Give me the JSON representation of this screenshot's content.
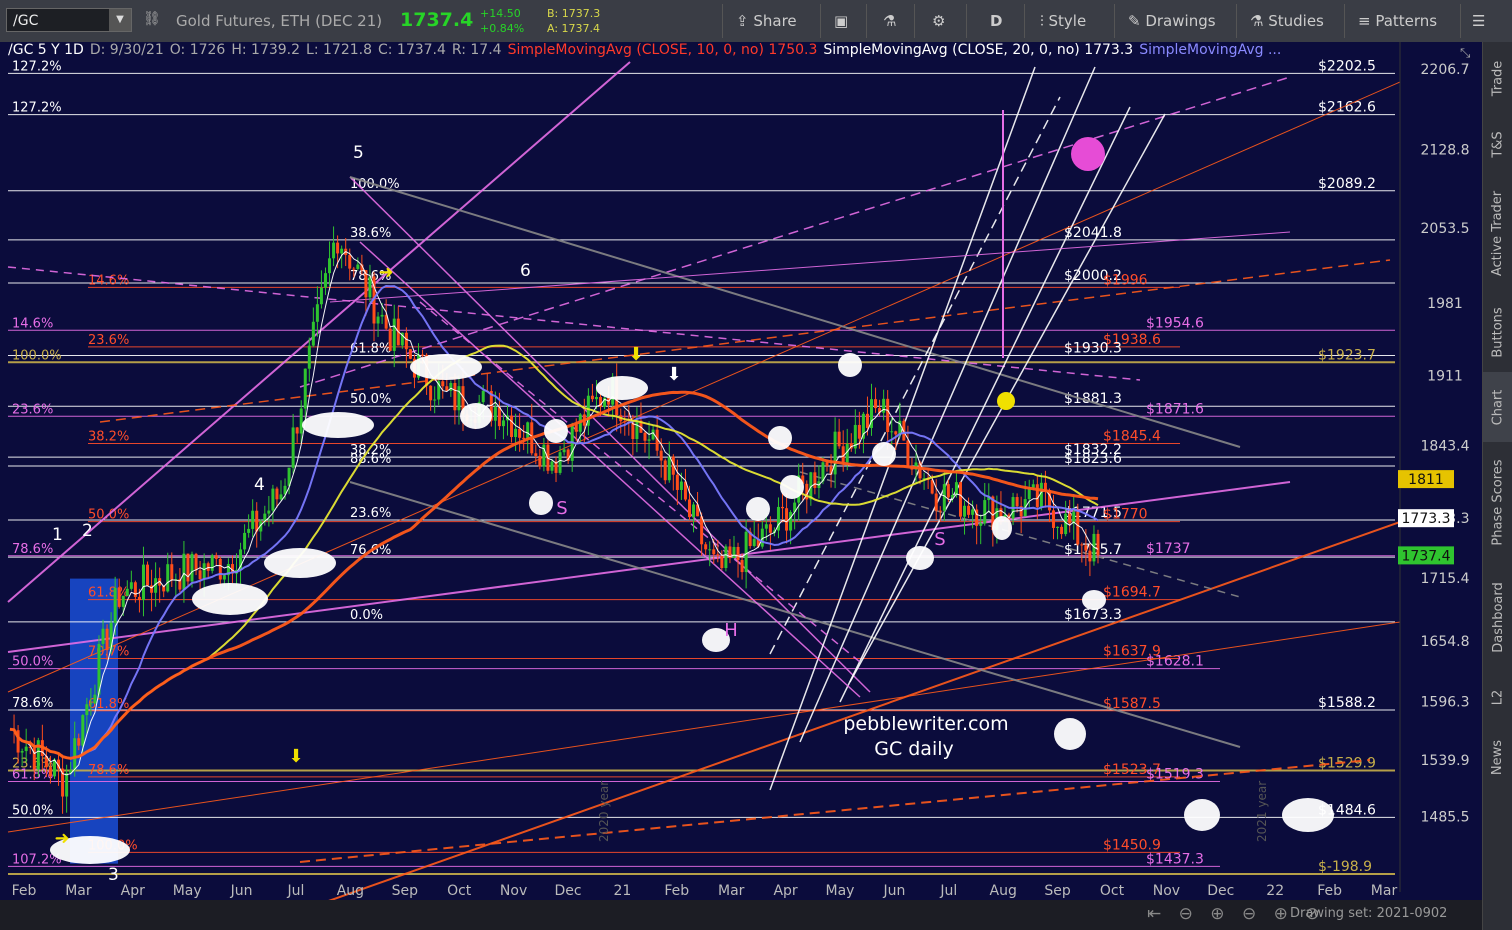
{
  "toolbar": {
    "symbol": "/GC",
    "title": "Gold Futures, ETH (DEC 21)",
    "last": "1737.4",
    "change": "+14.50",
    "change_pct": "+0.84%",
    "bid": "B: 1737.3",
    "ask": "A: 1737.4",
    "share": "Share",
    "period": "D",
    "style": "Style",
    "drawings": "Drawings",
    "studies": "Studies",
    "patterns": "Patterns"
  },
  "legend": {
    "symbol_info": "/GC 5 Y 1D",
    "date": "D: 9/30/21",
    "open": "O: 1726",
    "high": "H: 1739.2",
    "low": "L: 1721.8",
    "close": "C: 1737.4",
    "range": "R: 17.4",
    "sma10": "SimpleMovingAvg (CLOSE, 10, 0, no) 1750.3",
    "sma20": "SimpleMovingAvg (CLOSE, 20, 0, no) 1773.3",
    "sma_more": "SimpleMovingAvg ..."
  },
  "sidebar": [
    "Trade",
    "T&S",
    "Active Trader",
    "Buttons",
    "Chart",
    "Phase Scores",
    "Dashboard",
    "L2",
    "News"
  ],
  "watermark": "pebblewriter.com\nGC daily",
  "watermark_lines": [
    "pebblewriter.com",
    "GC daily"
  ],
  "drawing_set": "Drawing set: 2021-0902",
  "year_marks": [
    "2020 year",
    "2021 year"
  ],
  "colors": {
    "background": "#0b0c3c",
    "candle_up": "#2fc42f",
    "candle_down": "#ff4d1a",
    "sma_yellow": "#e6e633",
    "sma_orange": "#ff5a1a",
    "sma_blue": "#7a7aff",
    "fib_white": "#ffffff",
    "fib_pink": "#e66ee6",
    "fib_red": "#ff4d2a",
    "fib_gold": "#c8b04a"
  },
  "chart_data": {
    "type": "candlestick",
    "title": "GC daily",
    "ylim": [
      1430,
      2225
    ],
    "y_ticks": [
      2206.7,
      2128.8,
      2053.5,
      1981,
      1911,
      1843.4,
      1773.3,
      1715.4,
      1654.8,
      1596.3,
      1539.9,
      1485.5
    ],
    "x_ticks": [
      "Feb",
      "Mar",
      "Apr",
      "May",
      "Jun",
      "Jul",
      "Aug",
      "Sep",
      "Oct",
      "Nov",
      "Dec",
      "21",
      "Feb",
      "Mar",
      "Apr",
      "May",
      "Jun",
      "Jul",
      "Aug",
      "Sep",
      "Oct",
      "Nov",
      "Dec",
      "22",
      "Feb",
      "Mar"
    ],
    "price_badges": [
      {
        "label": "1811",
        "value": 1811,
        "color": "#e6c300",
        "text": "#111"
      },
      {
        "label": "1773.3",
        "value": 1773.3,
        "color": "#ffffff",
        "text": "#111"
      },
      {
        "label": "1737.4",
        "value": 1737.4,
        "color": "#2fc42f",
        "text": "#111"
      }
    ],
    "close_series_anchor": [
      [
        "Feb",
        1570
      ],
      [
        "Mar",
        1520
      ],
      [
        "Apr",
        1700
      ],
      [
        "May",
        1720
      ],
      [
        "Jun",
        1730
      ],
      [
        "Jul",
        1800
      ],
      [
        "Aug",
        2050
      ],
      [
        "Sep",
        1950
      ],
      [
        "Oct",
        1890
      ],
      [
        "Nov",
        1880
      ],
      [
        "Dec",
        1830
      ],
      [
        "21",
        1900
      ],
      [
        "Feb",
        1830
      ],
      [
        "Mar",
        1720
      ],
      [
        "Apr",
        1760
      ],
      [
        "May",
        1830
      ],
      [
        "Jun",
        1880
      ],
      [
        "Jul",
        1800
      ],
      [
        "Aug",
        1780
      ],
      [
        "Sep",
        1790
      ],
      [
        "Oct",
        1737.4
      ]
    ],
    "horizontal_levels": [
      {
        "label": "$2162.6",
        "value": 2162.6,
        "color": "#ffffff",
        "tag": "127.2%"
      },
      {
        "label": "$2089.2",
        "value": 2089.2,
        "color": "#ffffff",
        "tag": "100.0%"
      },
      {
        "label": "$2041.8",
        "value": 2041.8,
        "color": "#ffffff",
        "tag": "38.6%"
      },
      {
        "label": "$2000.2",
        "value": 2000.2,
        "color": "#ffffff",
        "tag": "78.6%"
      },
      {
        "label": "$1996",
        "value": 1996,
        "color": "#ff4d2a",
        "tag": "14.6%"
      },
      {
        "label": "$1954.6",
        "value": 1954.6,
        "color": "#e66ee6",
        "tag": "14.6%"
      },
      {
        "label": "$1938.6",
        "value": 1938.6,
        "color": "#ff4d2a",
        "tag": "23.6%"
      },
      {
        "label": "$1930.3",
        "value": 1930.3,
        "color": "#ffffff",
        "tag": "61.8%"
      },
      {
        "label": "$1923.7",
        "value": 1923.7,
        "color": "#c8b04a",
        "tag": "100.0%"
      },
      {
        "label": "$1881.3",
        "value": 1881.3,
        "color": "#ffffff",
        "tag": "50.0%"
      },
      {
        "label": "$1871.6",
        "value": 1871.6,
        "color": "#e66ee6",
        "tag": "23.6%"
      },
      {
        "label": "$1845.4",
        "value": 1845.4,
        "color": "#ff4d2a",
        "tag": "38.2%"
      },
      {
        "label": "$1832.2",
        "value": 1832.2,
        "color": "#ffffff",
        "tag": "38.2%"
      },
      {
        "label": "$1823.6",
        "value": 1823.6,
        "color": "#ffffff",
        "tag": "88.6%"
      },
      {
        "label": "$1771.5",
        "value": 1771.5,
        "color": "#ffffff",
        "tag": "23.6%"
      },
      {
        "label": "$1770",
        "value": 1770,
        "color": "#ff4d2a",
        "tag": "50.0%"
      },
      {
        "label": "$1737",
        "value": 1737,
        "color": "#e66ee6",
        "tag": "78.6%"
      },
      {
        "label": "$1735.7",
        "value": 1735.7,
        "color": "#ffffff",
        "tag": "76.6%"
      },
      {
        "label": "$1694.7",
        "value": 1694.7,
        "color": "#ff4d2a",
        "tag": "61.8%"
      },
      {
        "label": "$1673.3",
        "value": 1673.3,
        "color": "#ffffff",
        "tag": "0.0%"
      },
      {
        "label": "$1637.9",
        "value": 1637.9,
        "color": "#ff4d2a",
        "tag": "70.7%"
      },
      {
        "label": "$1628.1",
        "value": 1628.1,
        "color": "#e66ee6",
        "tag": "50.0%"
      },
      {
        "label": "$1588.2",
        "value": 1588.2,
        "color": "#ffffff",
        "tag": "78.6%"
      },
      {
        "label": "$1587.5",
        "value": 1587.5,
        "color": "#ff4d2a",
        "tag": "61.8%"
      },
      {
        "label": "$1529.9",
        "value": 1529.9,
        "color": "#c8b04a",
        "tag": "23.6%"
      },
      {
        "label": "$1523.7",
        "value": 1523.7,
        "color": "#ff4d2a",
        "tag": "78.6%"
      },
      {
        "label": "$1519.3",
        "value": 1519.3,
        "color": "#e66ee6",
        "tag": "61.8%"
      },
      {
        "label": "$1484.6",
        "value": 1484.6,
        "color": "#ffffff",
        "tag": "50.0%"
      },
      {
        "label": "$1450.9",
        "value": 1450.9,
        "color": "#ff4d2a",
        "tag": "100.0%"
      },
      {
        "label": "$1437.3",
        "value": 1437.3,
        "color": "#e66ee6",
        "tag": "107.2%"
      },
      {
        "label": "$-198.9",
        "value": 1430,
        "color": "#c8b04a",
        "tag": ""
      },
      {
        "label": "$2202.5",
        "value": 2202.5,
        "color": "#ffffff",
        "tag": "127.2%"
      }
    ],
    "wave_labels": [
      "1",
      "2",
      "3",
      "4",
      "5",
      "6"
    ],
    "pattern_labels": [
      "S",
      "H",
      "S"
    ]
  }
}
